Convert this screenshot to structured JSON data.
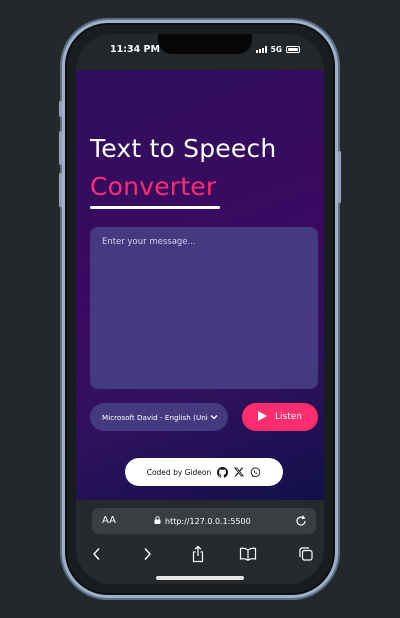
{
  "status": {
    "time": "11:34 PM",
    "network": "5G"
  },
  "app": {
    "title_line1": "Text to Speech",
    "title_line2": "Converter",
    "message_placeholder": "Enter your message...",
    "voice_selected": "Microsoft David - English (United States)",
    "listen_label": "Listen",
    "credit_text": "Coded by Gideon",
    "accent_color": "#ff2d6f",
    "icons": [
      "play-icon",
      "github-icon",
      "x-icon",
      "whatsapp-icon"
    ]
  },
  "browser": {
    "text_size_label": "AA",
    "url": "http://127.0.0.1:5500",
    "nav_icons": [
      "back-icon",
      "forward-icon",
      "share-icon",
      "bookmarks-icon",
      "tabs-icon"
    ]
  }
}
